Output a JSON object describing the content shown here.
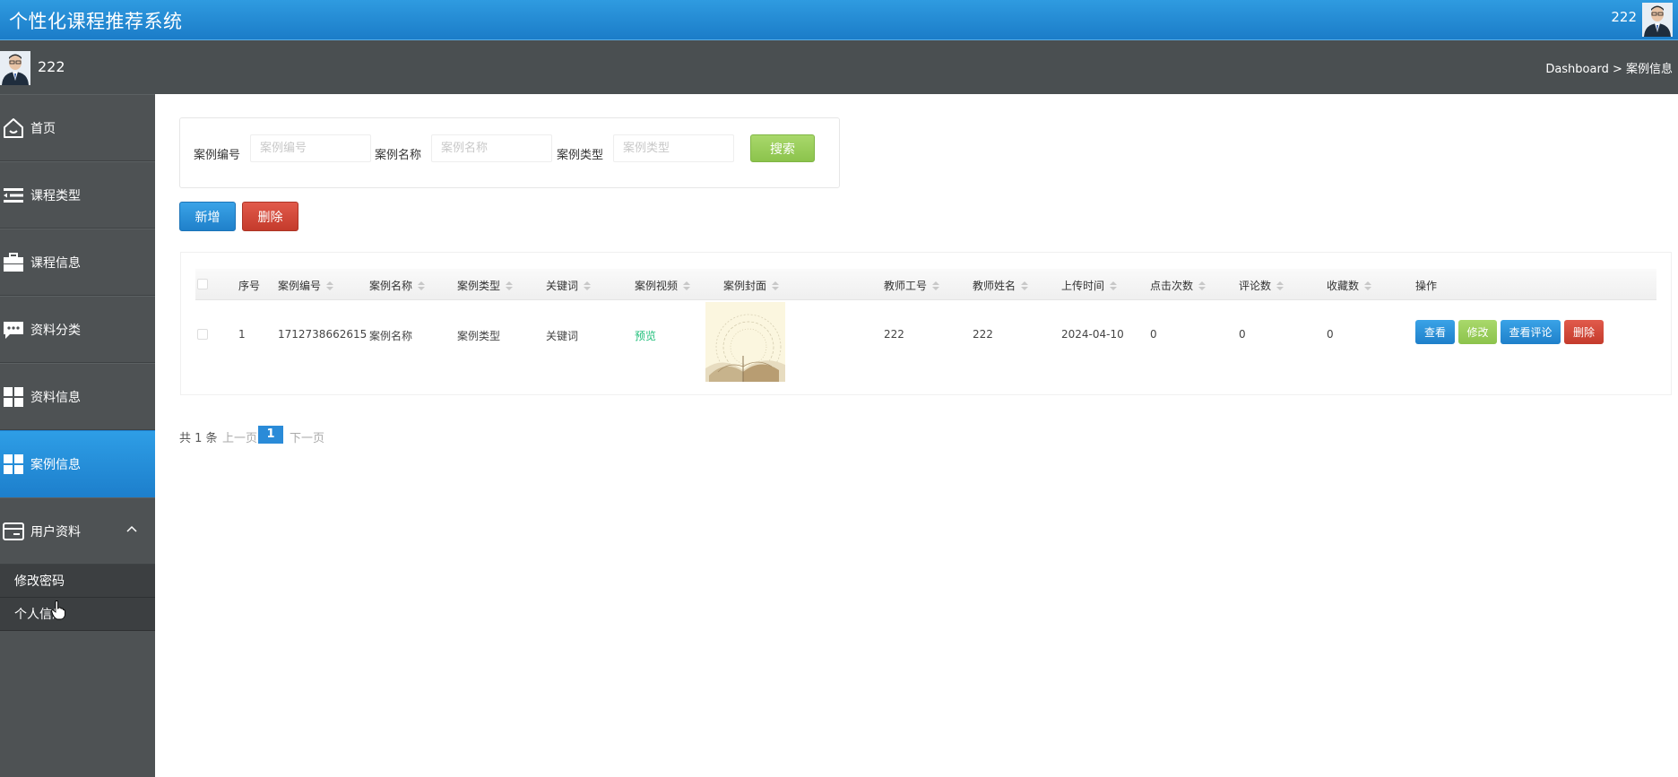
{
  "header": {
    "title": "个性化课程推荐系统",
    "username": "222"
  },
  "userbar": {
    "username": "222",
    "breadcrumb": "Dashboard > 案例信息"
  },
  "sidebar": {
    "items": [
      {
        "label": "首页",
        "icon": "home-icon"
      },
      {
        "label": "课程类型",
        "icon": "list-icon"
      },
      {
        "label": "课程信息",
        "icon": "briefcase-icon"
      },
      {
        "label": "资料分类",
        "icon": "chat-icon"
      },
      {
        "label": "资料信息",
        "icon": "grid-icon"
      },
      {
        "label": "案例信息",
        "icon": "grid-icon",
        "active": true
      },
      {
        "label": "用户资料",
        "icon": "card-icon",
        "expanded": true
      }
    ],
    "subitems": [
      "修改密码",
      "个人信息"
    ]
  },
  "search": {
    "fields": [
      {
        "label": "案例编号",
        "placeholder": "案例编号"
      },
      {
        "label": "案例名称",
        "placeholder": "案例名称"
      },
      {
        "label": "案例类型",
        "placeholder": "案例类型"
      }
    ],
    "button": "搜索"
  },
  "actions": {
    "add": "新增",
    "delete": "删除"
  },
  "table": {
    "headers": [
      "序号",
      "案例编号",
      "案例名称",
      "案例类型",
      "关键词",
      "案例视频",
      "案例封面",
      "教师工号",
      "教师姓名",
      "上传时间",
      "点击次数",
      "评论数",
      "收藏数",
      "操作"
    ],
    "rows": [
      {
        "index": "1",
        "case_no": "1712738662615",
        "case_name": "案例名称",
        "case_type": "案例类型",
        "keyword": "关键词",
        "video": "预览",
        "teacher_no": "222",
        "teacher_name": "222",
        "upload_time": "2024-04-10",
        "clicks": "0",
        "comments": "0",
        "favorites": "0",
        "buttons": {
          "view": "查看",
          "edit": "修改",
          "view_comments": "查看评论",
          "delete": "删除"
        }
      }
    ]
  },
  "pager": {
    "total": "共 1 条",
    "prev": "上一页",
    "page": "1",
    "next": "下一页"
  },
  "colors": {
    "header": "#1b7cc8",
    "sidebar": "#4e5254",
    "active": "#2e9ee6",
    "green": "#8cc34c",
    "red": "#c43b2c"
  }
}
